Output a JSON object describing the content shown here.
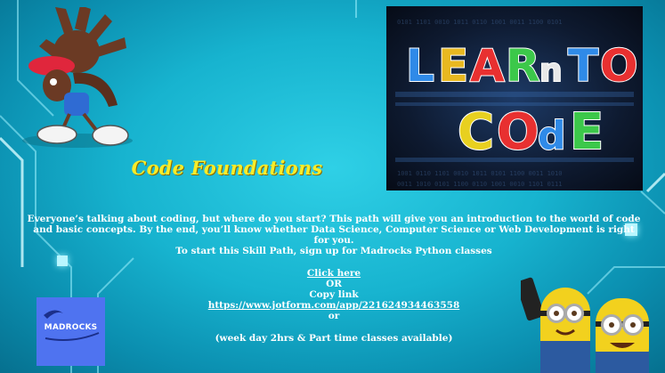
{
  "title": "Code Foundations",
  "hero": {
    "line1": "LEARn TO",
    "line2": "COdE"
  },
  "description": {
    "intro": "Everyone’s talking about coding, but where do you start? This path will give you an introduction to the world of code and basic concepts. By the end, you’ll know whether Data Science, Computer Science or Web Development is right for you.",
    "signup": "To start this Skill Path, sign up for Madrocks Python classes",
    "click_here": "Click here",
    "or1": "OR",
    "copy_link": "Copy link",
    "url": "https://www.jotform.com/app/221624934463558",
    "or2": "or",
    "schedule": "(week day 2hrs & Part time classes available)"
  },
  "logo": {
    "text": "MADROCKS",
    "color": "#4f73f0"
  },
  "colors": {
    "title": "#f7ec2a",
    "background": "#17b3cf"
  }
}
